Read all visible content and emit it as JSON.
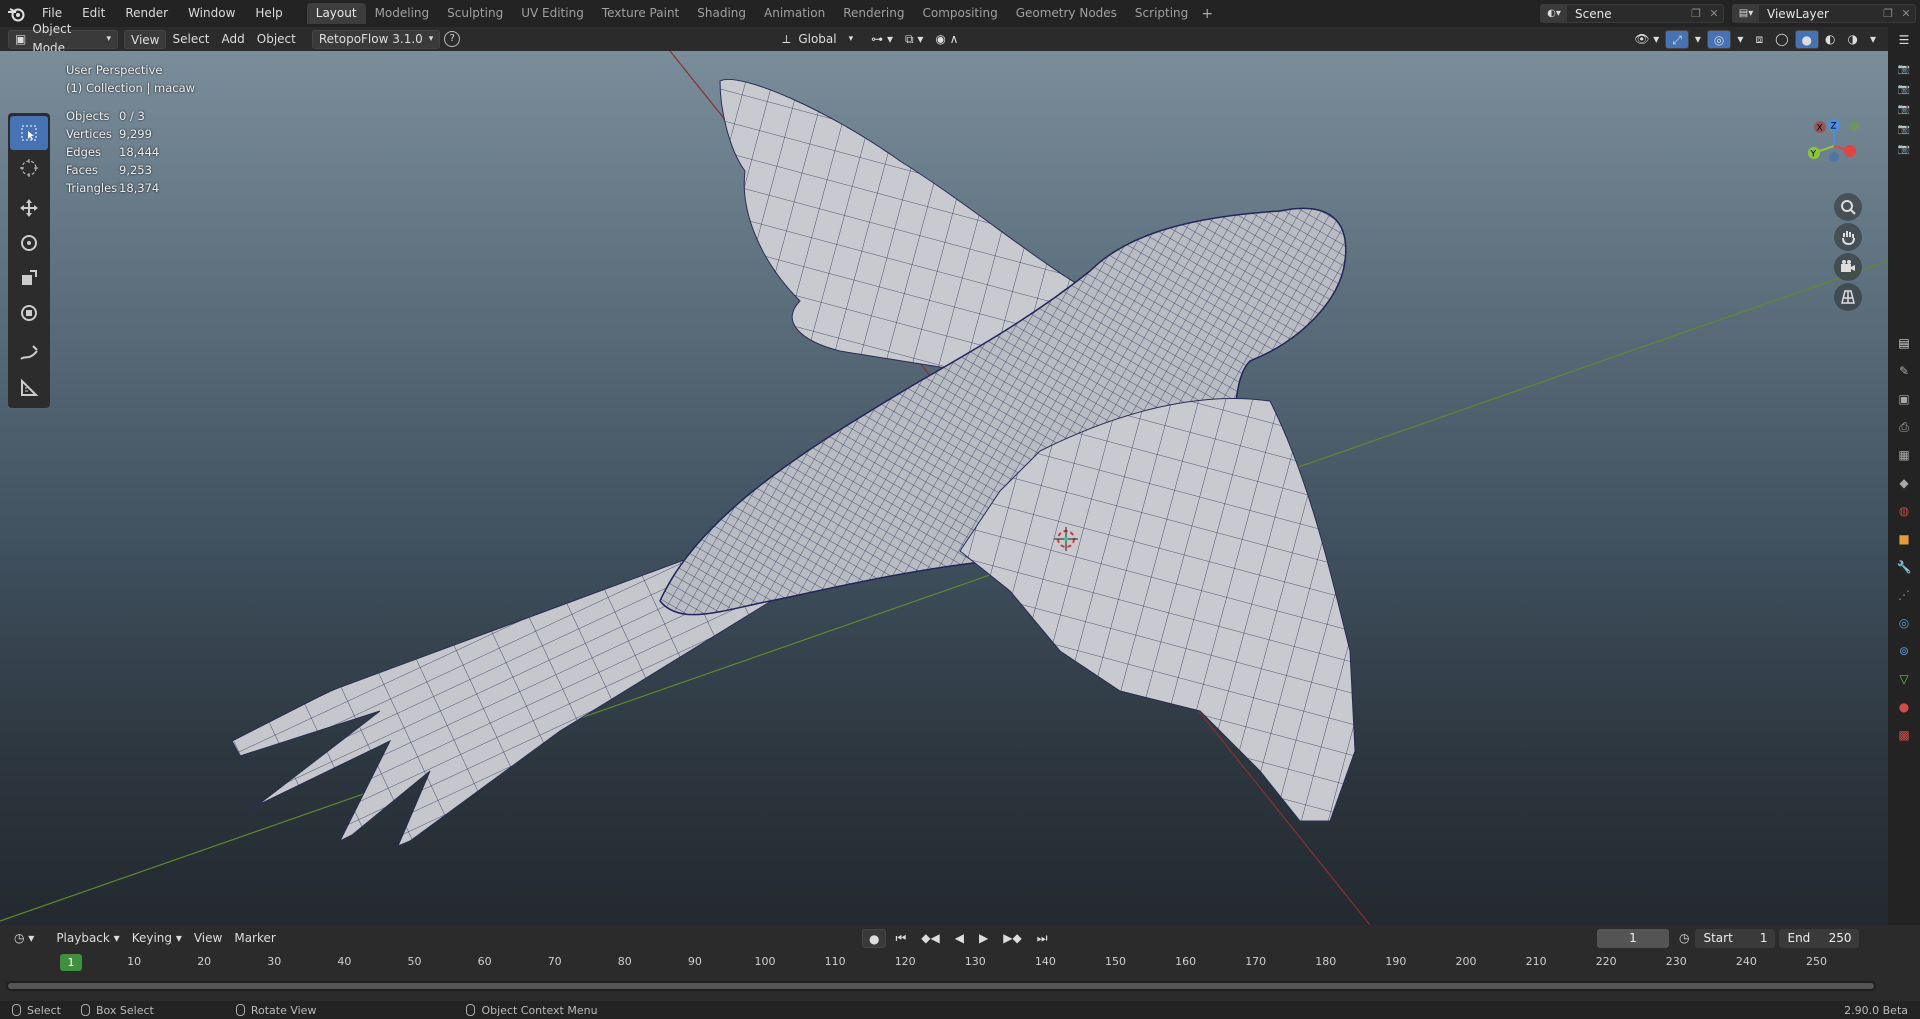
{
  "menu": {
    "items": [
      "File",
      "Edit",
      "Render",
      "Window",
      "Help"
    ]
  },
  "workspaces": {
    "tabs": [
      "Layout",
      "Modeling",
      "Sculpting",
      "UV Editing",
      "Texture Paint",
      "Shading",
      "Animation",
      "Rendering",
      "Compositing",
      "Geometry Nodes",
      "Scripting"
    ],
    "active": "Layout",
    "add": "+"
  },
  "scene": {
    "name": "Scene",
    "view_layer": "ViewLayer"
  },
  "header": {
    "mode": "Object Mode",
    "view": "View",
    "select": "Select",
    "add": "Add",
    "object": "Object",
    "addon": "RetopoFlow 3.1.0",
    "help": "?",
    "orientation": "Global"
  },
  "viewport": {
    "perspective": "User Perspective",
    "collection": "(1) Collection | macaw",
    "stats": [
      {
        "label": "Objects",
        "value": "0 / 3"
      },
      {
        "label": "Vertices",
        "value": "9,299"
      },
      {
        "label": "Edges",
        "value": "18,444"
      },
      {
        "label": "Faces",
        "value": "9,253"
      },
      {
        "label": "Triangles",
        "value": "18,374"
      }
    ],
    "gizmo": {
      "x": "X",
      "y": "Y",
      "z": "Z"
    }
  },
  "tools": [
    "select-box",
    "cursor",
    "move",
    "rotate",
    "scale",
    "transform",
    "annotate",
    "measure"
  ],
  "timeline": {
    "playback": "Playback",
    "keying": "Keying",
    "view": "View",
    "marker": "Marker",
    "current_frame": "1",
    "start_label": "Start",
    "start": "1",
    "end_label": "End",
    "end": "250",
    "ticks": [
      "10",
      "20",
      "30",
      "40",
      "50",
      "60",
      "70",
      "80",
      "90",
      "100",
      "110",
      "120",
      "130",
      "140",
      "150",
      "160",
      "170",
      "180",
      "190",
      "200",
      "210",
      "220",
      "230",
      "240",
      "250"
    ],
    "cursor_frame": "1"
  },
  "status": {
    "select": "Select",
    "box_select": "Box Select",
    "rotate_view": "Rotate View",
    "context_menu": "Object Context Menu",
    "version": "2.90.0 Beta"
  },
  "colors": {
    "accent": "#4772b3",
    "x_axis": "#e04545",
    "y_axis": "#8cc63f",
    "z_axis": "#4a8fe6",
    "frame_green": "#3f8f3f"
  }
}
